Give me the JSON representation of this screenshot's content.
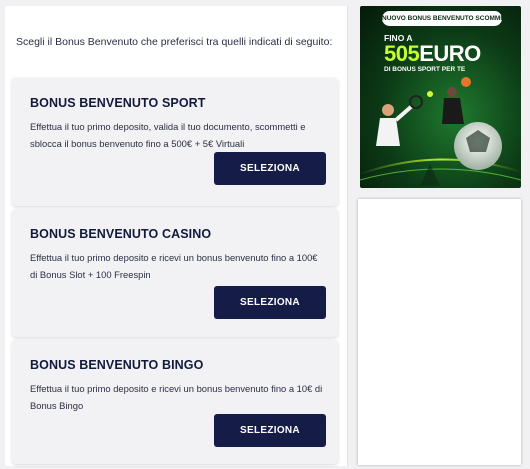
{
  "intro": "Scegli il Bonus Benvenuto che preferisci tra quelli indicati di seguito:",
  "bonuses": [
    {
      "title": "BONUS BENVENUTO SPORT",
      "description": "Effettua il tuo primo deposito, valida il tuo documento, scommetti e sblocca il bonus benvenuto fino a 500€ + 5€ Virtuali",
      "button_label": "SELEZIONA"
    },
    {
      "title": "BONUS BENVENUTO CASINO",
      "description": "Effettua il tuo primo deposito e ricevi un bonus benvenuto fino a 100€ di Bonus Slot + 100 Freespin",
      "button_label": "SELEZIONA"
    },
    {
      "title": "BONUS BENVENUTO BINGO",
      "description": "Effettua il tuo primo deposito e ricevi un bonus benvenuto fino a 10€ di Bonus Bingo",
      "button_label": "SELEZIONA"
    }
  ],
  "banner": {
    "badge": "NUOVO BONUS BENVENUTO SCOMMESSE",
    "prefix": "FINO A",
    "amount": "505",
    "currency": "EURO",
    "subtitle": "DI BONUS SPORT PER TE"
  },
  "colors": {
    "button_bg": "#151c48",
    "title": "#111a3a",
    "banner_accent": "#c6ff2e"
  }
}
